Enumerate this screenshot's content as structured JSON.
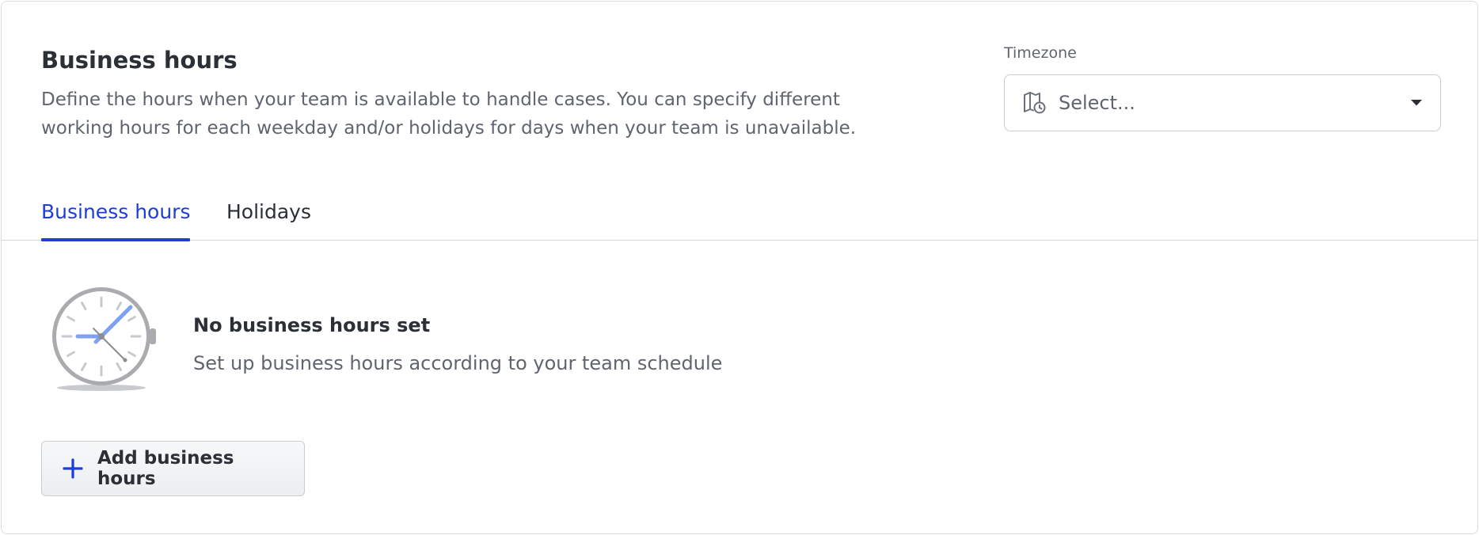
{
  "header": {
    "title": "Business hours",
    "description": "Define the hours when your team is available to handle cases. You can specify different working hours for each weekday and/or holidays for days when your team is unavailable."
  },
  "timezone": {
    "label": "Timezone",
    "placeholder": "Select...",
    "icon": "map-clock-icon"
  },
  "tabs": [
    {
      "label": "Business hours",
      "active": true
    },
    {
      "label": "Holidays",
      "active": false
    }
  ],
  "empty_state": {
    "title": "No business hours set",
    "subtitle": "Set up business hours according to your team schedule",
    "illustration": "clock-illustration"
  },
  "actions": {
    "add_label": "Add business hours"
  },
  "colors": {
    "accent": "#1f3dd6",
    "text_primary": "#2b2f36",
    "text_secondary": "#60656d",
    "clock_hand": "#7ea2f2"
  }
}
